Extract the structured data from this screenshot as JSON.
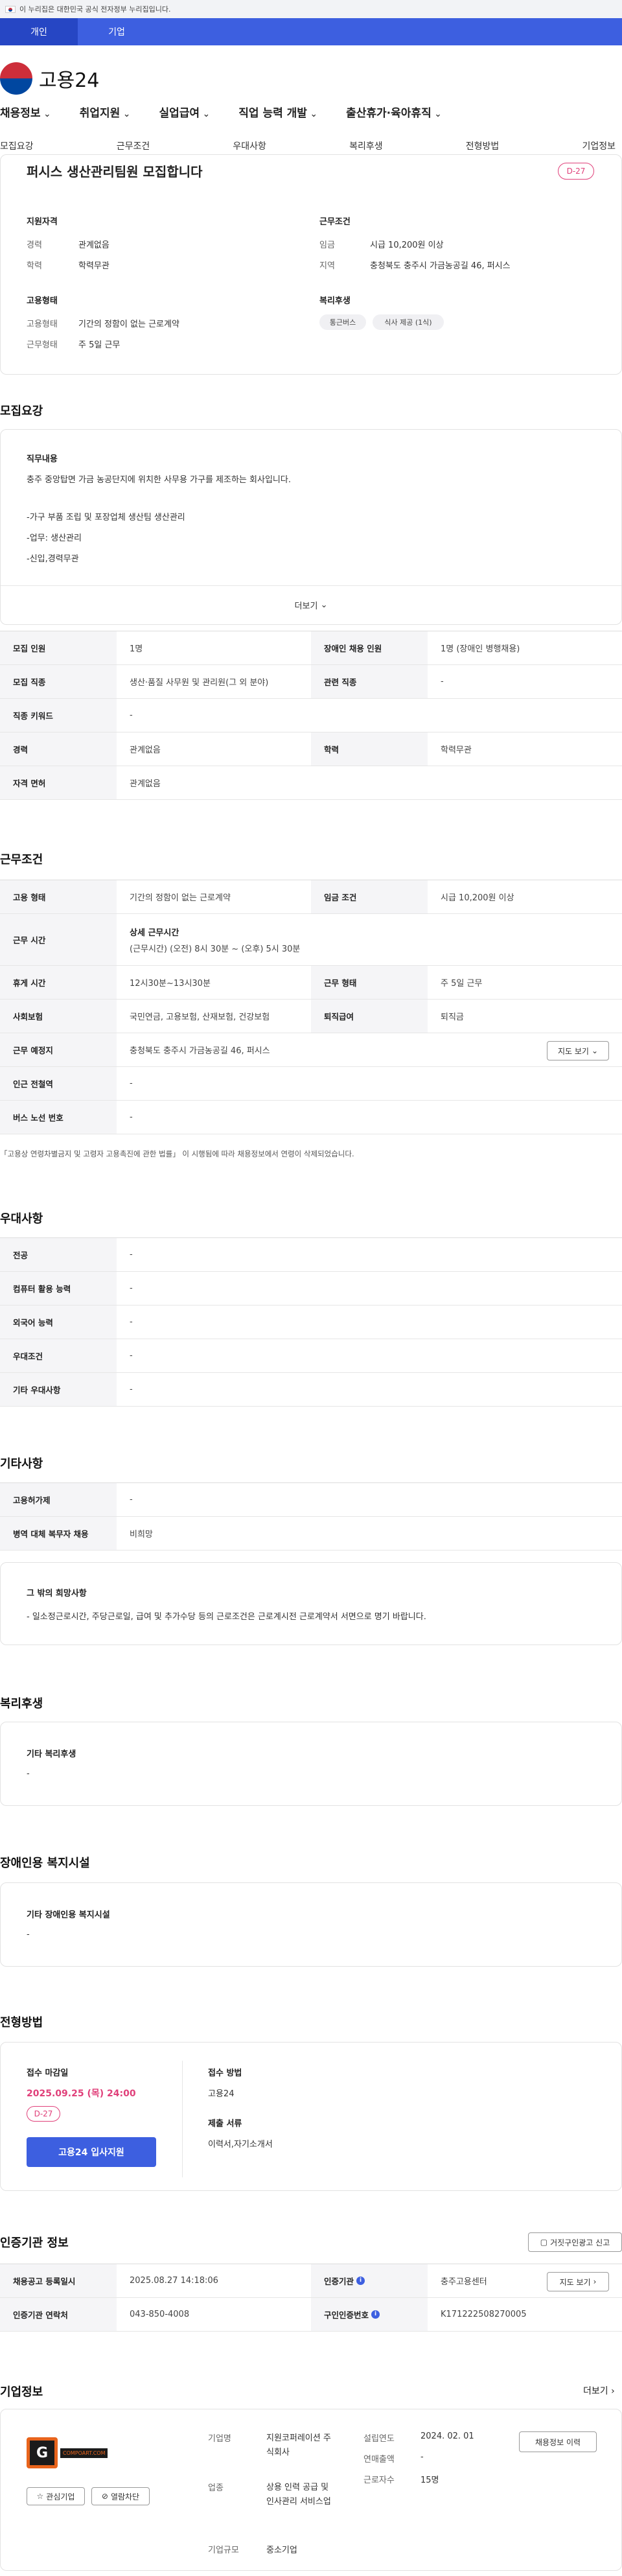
{
  "gov_banner": "이 누리집은 대한민국 공식 전자정부 누리집입니다.",
  "user_tabs": [
    "개인",
    "기업"
  ],
  "logo_text": "고용24",
  "gnb": [
    "채용정보",
    "취업지원",
    "실업급여",
    "직업 능력 개발",
    "출산휴가·육아휴직"
  ],
  "subnav": [
    "모집요강",
    "근무조건",
    "우대사항",
    "복리후생",
    "전형방법",
    "기업정보"
  ],
  "summary": {
    "title": "퍼시스 생산관리팀원 모집합니다",
    "dday": "D-27",
    "qual_label": "지원자격",
    "career_k": "경력",
    "career_v": "관계없음",
    "edu_k": "학력",
    "edu_v": "학력무관",
    "work_label": "근무조건",
    "wage_k": "임금",
    "wage_v": "시급 10,200원 이상",
    "region_k": "지역",
    "region_v": "충청북도 충주시 가금농공길 46, 퍼시스",
    "emp_label": "고용형태",
    "emptype_k": "고용형태",
    "emptype_v": "기간의 정함이 없는 근로계약",
    "workform_k": "근무형태",
    "workform_v": "주 5일 근무",
    "welfare_label": "복리후생",
    "welfare_tags": [
      "통근버스",
      "식사 제공 (1식)"
    ]
  },
  "recruit": {
    "title": "모집요강",
    "duty_label": "직무내용",
    "lines": [
      "충주 중앙탑면 가금 농공단지에 위치한 사무용 가구를 제조하는 회사입니다.",
      "",
      "-가구 부품 조립 및 포장업체 생산팀 생산관리",
      "",
      "-업무: 생산관리",
      "",
      "-신입,경력무관"
    ],
    "more": "더보기",
    "rows": [
      [
        "모집 인원",
        "1명",
        "장애인 채용 인원",
        "1명 (장애인 병행채용)"
      ],
      [
        "모집 직종",
        "생산·품질 사무원 및 관리원(그 외 분야)",
        "관련 직종",
        "-"
      ],
      [
        "직종 키워드",
        "-"
      ],
      [
        "경력",
        "관계없음",
        "학력",
        "학력무관"
      ],
      [
        "자격 면허",
        "관계없음"
      ]
    ]
  },
  "work": {
    "title": "근무조건",
    "emp_k": "고용 형태",
    "emp_v": "기간의 정함이 없는 근로계약",
    "wage_k": "임금 조건",
    "wage_v": "시급 10,200원 이상",
    "time_k": "근무 시간",
    "time_head": "상세 근무시간",
    "time_v": "(근무시간) (오전) 8시 30분 ~ (오후) 5시 30분",
    "rest_k": "휴게 시간",
    "rest_v": "12시30분~13시30분",
    "form_k": "근무 형태",
    "form_v": "주 5일 근무",
    "ins_k": "사회보험",
    "ins_v": "국민연금, 고용보험, 산재보험, 건강보험",
    "ret_k": "퇴직급여",
    "ret_v": "퇴직금",
    "place_k": "근무 예정지",
    "place_v": "충청북도 충주시 가금농공길 46, 퍼시스",
    "map_btn": "지도 보기",
    "subway_k": "인근 전철역",
    "subway_v": "-",
    "bus_k": "버스 노선 번호",
    "bus_v": "-",
    "note": "「고용상 연령차별금지 및 고령자 고용촉진에 관한 법률」 이 시행됨에 따라 채용정보에서 연령이 삭제되었습니다."
  },
  "pref": {
    "title": "우대사항",
    "rows": [
      [
        "전공",
        "-"
      ],
      [
        "컴퓨터 활용 능력",
        "-"
      ],
      [
        "외국어 능력",
        "-"
      ],
      [
        "우대조건",
        "-"
      ],
      [
        "기타 우대사항",
        "-"
      ]
    ]
  },
  "etc": {
    "title": "기타사항",
    "rows": [
      [
        "고용허가제",
        "-"
      ],
      [
        "병역 대체 복무자 채용",
        "비희망"
      ]
    ],
    "box_label": "그 밖의 희망사항",
    "box_text": "- 일소정근로시간, 주당근로일, 급여 및 추가수당 등의 근로조건은 근로계시전 근로계약서 서면으로 명기 바랍니다."
  },
  "welfare": {
    "title": "복리후생",
    "label": "기타 복리후생",
    "value": "-"
  },
  "disabled": {
    "title": "장애인용 복지시설",
    "label": "기타 장애인용 복지시설",
    "value": "-"
  },
  "apply": {
    "title": "전형방법",
    "deadline_label": "접수 마감일",
    "deadline": "2025.09.25 (목) 24:00",
    "dday": "D-27",
    "apply_btn": "고용24 입사지원",
    "method_label": "접수 방법",
    "method": "고용24",
    "docs_label": "제출 서류",
    "docs": "이력서,자기소개서"
  },
  "cert": {
    "title": "인증기관 정보",
    "report_btn": "거짓구인광고 신고",
    "reg_k": "채용공고 등록일시",
    "reg_v": "2025.08.27 14:18:06",
    "org_k": "인증기관",
    "org_v": "충주고용센터",
    "map_btn": "지도 보기",
    "tel_k": "인증기관 연락처",
    "tel_v": "043-850-4008",
    "no_k": "구인인증번호",
    "no_v": "K171222508270005"
  },
  "company": {
    "title": "기업정보",
    "more": "더보기",
    "logo_text": "COMPOART.COM",
    "fav_btn": "관심기업",
    "block_btn": "열람차단",
    "name_k": "기업명",
    "name_v": "지원코퍼레이션 주식회사",
    "biz_k": "업종",
    "biz_v": "상용 인력 공급 및 인사관리 서비스업",
    "size_k": "기업규모",
    "size_v": "중소기업",
    "est_k": "설립연도",
    "est_v": "2024. 02. 01",
    "sales_k": "연매출액",
    "sales_v": "-",
    "emp_k": "근로자수",
    "emp_v": "15명",
    "history_btn": "채용정보 이력"
  }
}
